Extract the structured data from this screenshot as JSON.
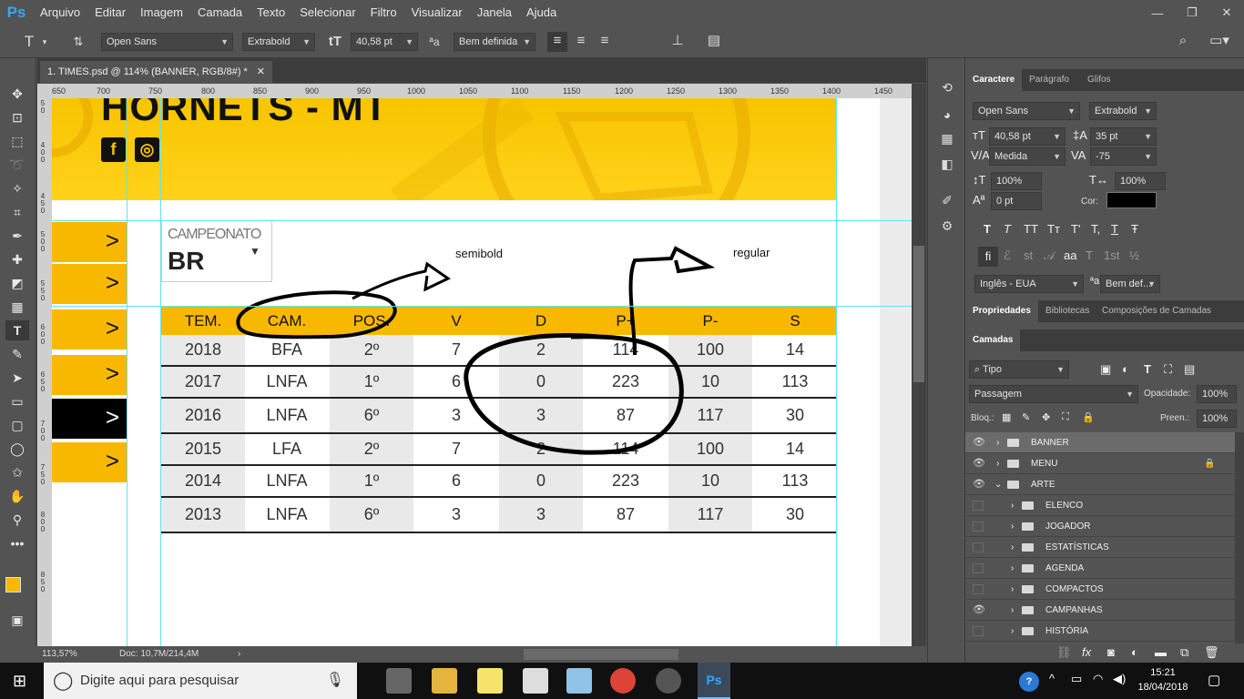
{
  "menubar": {
    "logo": "Ps",
    "items": [
      "Arquivo",
      "Editar",
      "Imagem",
      "Camada",
      "Texto",
      "Selecionar",
      "Filtro",
      "Visualizar",
      "Janela",
      "Ajuda"
    ],
    "window_controls": [
      "—",
      "❐",
      "✕"
    ]
  },
  "options": {
    "tool_glyph": "T",
    "font_family": "Open Sans",
    "font_style": "Extrabold",
    "font_size": "40,58 pt",
    "aa_label": "a",
    "antialias": "Bem definida"
  },
  "document": {
    "tab_title": "1. TIMES.psd @ 114% (BANNER, RGB/8#) *",
    "zoom": "113,57%",
    "doc_info": "Doc: 10,7M/214,4M"
  },
  "ruler_ticks": [
    "650",
    "700",
    "750",
    "800",
    "850",
    "900",
    "950",
    "1000",
    "1050",
    "1100",
    "1150",
    "1200",
    "1250",
    "1300",
    "1350",
    "1400",
    "1450"
  ],
  "ruler_v_ticks": [
    "5 0",
    "4 0 0",
    "4 5 0",
    "5 0 0",
    "5 5 0",
    "6 0 0",
    "6 5 0",
    "7 0 0",
    "7 5 0",
    "8 0 0",
    "8 5 0"
  ],
  "canvas": {
    "banner_title": "HORNETS - MT",
    "social": [
      "f",
      "◎"
    ],
    "side_arrows": [
      ">",
      ">",
      ">",
      ">",
      ">",
      ">"
    ],
    "campeonato_label": "CAMPEONATO",
    "campeonato_value": "BR",
    "annotations": {
      "semibold": "semibold",
      "regular": "regular"
    },
    "table": {
      "headers": [
        "TEM.",
        "CAM.",
        "POS.",
        "V",
        "D",
        "P+",
        "P-",
        "S"
      ],
      "rows": [
        [
          "2018",
          "BFA",
          "2º",
          "7",
          "2",
          "114",
          "100",
          "14"
        ],
        [
          "2017",
          "LNFA",
          "1º",
          "6",
          "0",
          "223",
          "10",
          "113"
        ],
        [
          "2016",
          "LNFA",
          "6º",
          "3",
          "3",
          "87",
          "117",
          "30"
        ],
        [
          "2015",
          "LFA",
          "2º",
          "7",
          "2",
          "114",
          "100",
          "14"
        ],
        [
          "2014",
          "LNFA",
          "1º",
          "6",
          "0",
          "223",
          "10",
          "113"
        ],
        [
          "2013",
          "LNFA",
          "6º",
          "3",
          "3",
          "87",
          "117",
          "30"
        ]
      ]
    }
  },
  "character_panel": {
    "tabs": [
      "Caractere",
      "Parágrafo",
      "Glifos"
    ],
    "font_family": "Open Sans",
    "font_style": "Extrabold",
    "size": "40,58 pt",
    "leading": "35 pt",
    "kerning": "Medida",
    "tracking": "-75",
    "vscale": "100%",
    "hscale": "100%",
    "baseline": "0 pt",
    "color_label": "Cor:",
    "style_buttons": [
      "T",
      "T",
      "TT",
      "Tт",
      "T'",
      "T,",
      "T",
      "Ŧ"
    ],
    "opentype_buttons": [
      "fi",
      "ℰ",
      "st",
      "𝒜",
      "aa",
      "T",
      "1st",
      "½"
    ],
    "language": "Inglês - EUA",
    "antialias": "Bem def..."
  },
  "properties_tabs": [
    "Propriedades",
    "Bibliotecas",
    "Composições de Camadas"
  ],
  "layers_panel": {
    "title": "Camadas",
    "filter": "Tipo",
    "blend_mode": "Passagem",
    "opacity_label": "Opacidade:",
    "opacity": "100%",
    "lock_label": "Bloq.:",
    "fill_label": "Preen.:",
    "fill": "100%",
    "layers": [
      {
        "name": "BANNER",
        "visible": true,
        "indent": 0,
        "open": false,
        "selected": true,
        "locked": false
      },
      {
        "name": "MENU",
        "visible": true,
        "indent": 0,
        "open": false,
        "selected": false,
        "locked": true
      },
      {
        "name": "ARTE",
        "visible": true,
        "indent": 0,
        "open": true,
        "selected": false,
        "locked": false
      },
      {
        "name": "ELENCO",
        "visible": false,
        "indent": 1,
        "open": false,
        "selected": false,
        "locked": false
      },
      {
        "name": "JOGADOR",
        "visible": false,
        "indent": 1,
        "open": false,
        "selected": false,
        "locked": false
      },
      {
        "name": "ESTATÍSTICAS",
        "visible": false,
        "indent": 1,
        "open": false,
        "selected": false,
        "locked": false
      },
      {
        "name": "AGENDA",
        "visible": false,
        "indent": 1,
        "open": false,
        "selected": false,
        "locked": false
      },
      {
        "name": "COMPACTOS",
        "visible": false,
        "indent": 1,
        "open": false,
        "selected": false,
        "locked": false
      },
      {
        "name": "CAMPANHAS",
        "visible": true,
        "indent": 1,
        "open": false,
        "selected": false,
        "locked": false
      },
      {
        "name": "HISTÓRIA",
        "visible": false,
        "indent": 1,
        "open": false,
        "selected": false,
        "locked": false
      }
    ],
    "footer_icons": [
      "link-icon",
      "fx-icon",
      "mask-icon",
      "adjustment-icon",
      "group-icon",
      "new-layer-icon",
      "trash-icon"
    ]
  },
  "taskbar": {
    "search_placeholder": "Digite aqui para pesquisar",
    "time": "15:21",
    "date": "18/04/2018"
  },
  "colors": {
    "accent_yellow": "#f9b800",
    "guide": "#5fe5f0",
    "ps_blue": "#31a8ff"
  }
}
